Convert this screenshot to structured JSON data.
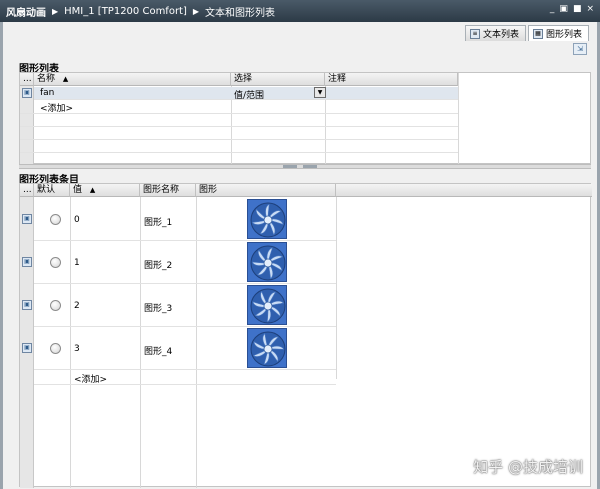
{
  "titlebar": {
    "crumbs": [
      "风扇动画",
      "HMI_1 [TP1200 Comfort]",
      "文本和图形列表"
    ],
    "controls": [
      "_",
      "▣",
      "■",
      "×"
    ]
  },
  "tabs": [
    {
      "label": "文本列表",
      "icon": "text-list-icon"
    },
    {
      "label": "图形列表",
      "icon": "graphic-list-icon"
    }
  ],
  "graphic_list": {
    "title": "图形列表",
    "columns": {
      "dots": "...",
      "name": "名称",
      "sort": "▲",
      "selection": "选择",
      "comment": "注释"
    },
    "rows": [
      {
        "name": "fan",
        "selection": "值/范围",
        "comment": ""
      }
    ],
    "add_label": "<添加>"
  },
  "graphic_entries": {
    "title": "图形列表条目",
    "columns": {
      "dots": "...",
      "default": "默认",
      "value": "值",
      "sort": "▲",
      "graphic_name": "图形名称",
      "graphic": "图形"
    },
    "rows": [
      {
        "value": "0",
        "graphic_name": "图形_1",
        "image": "fan-image"
      },
      {
        "value": "1",
        "graphic_name": "图形_2",
        "image": "fan-image"
      },
      {
        "value": "2",
        "graphic_name": "图形_3",
        "image": "fan-image"
      },
      {
        "value": "3",
        "graphic_name": "图形_4",
        "image": "fan-image"
      }
    ],
    "add_label": "<添加>"
  },
  "watermark": "知乎 @技成培训",
  "colors": {
    "title_bar": "#2c3a46",
    "fan_bg": "#3f72c9",
    "fan_blade": "#c9dcf5"
  }
}
